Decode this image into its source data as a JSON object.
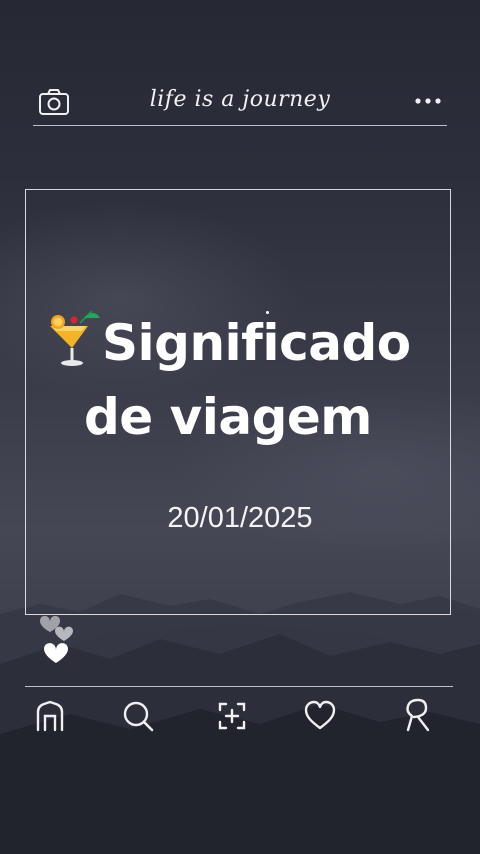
{
  "header": {
    "title": "life is a journey",
    "left_icon": "camera-icon",
    "right_icon": "more-dots-icon"
  },
  "post": {
    "emoji": "tropical-drink-icon",
    "title_line1": "Significado",
    "title_line2": "de viagem",
    "date": "20/01/2025"
  },
  "decor": {
    "hearts": "hearts-icon"
  },
  "nav": {
    "items": [
      "home-icon",
      "search-icon",
      "add-post-icon",
      "favorites-icon",
      "profile-icon"
    ]
  },
  "colors": {
    "text": "#ffffff",
    "lines": "#d8d8de",
    "sky_dark": "#262833",
    "sky_mid": "#454755"
  }
}
